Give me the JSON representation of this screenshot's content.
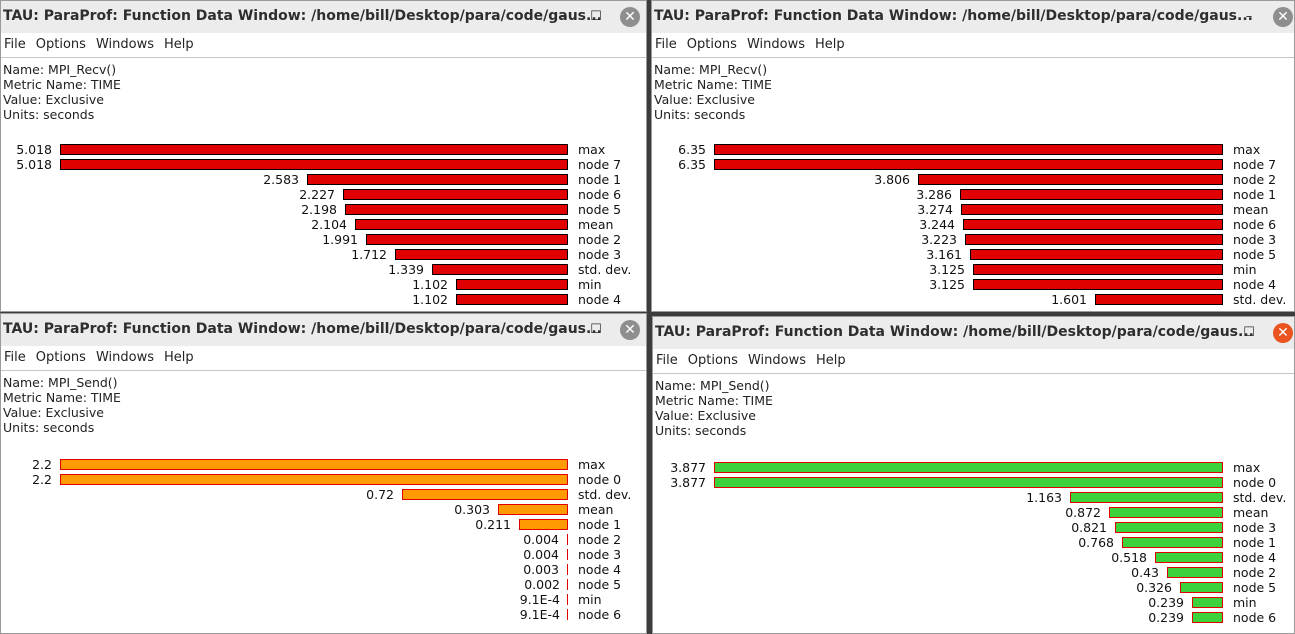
{
  "menu": [
    "File",
    "Options",
    "Windows",
    "Help"
  ],
  "windows": [
    {
      "title": "TAU: ParaProf: Function Data Window: /home/bill/Desktop/para/code/gaus...",
      "info": {
        "name": "Name: MPI_Recv()",
        "metric": "Metric Name: TIME",
        "value": "Value: Exclusive",
        "units": "Units: seconds"
      },
      "bar_color": "red",
      "max_value": 5.018,
      "rows": [
        {
          "value": "5.018",
          "v": 5.018,
          "label": "max"
        },
        {
          "value": "5.018",
          "v": 5.018,
          "label": "node 7"
        },
        {
          "value": "2.583",
          "v": 2.583,
          "label": "node 1"
        },
        {
          "value": "2.227",
          "v": 2.227,
          "label": "node 6"
        },
        {
          "value": "2.198",
          "v": 2.198,
          "label": "node 5"
        },
        {
          "value": "2.104",
          "v": 2.104,
          "label": "mean"
        },
        {
          "value": "1.991",
          "v": 1.991,
          "label": "node 2"
        },
        {
          "value": "1.712",
          "v": 1.712,
          "label": "node 3"
        },
        {
          "value": "1.339",
          "v": 1.339,
          "label": "std. dev."
        },
        {
          "value": "1.102",
          "v": 1.102,
          "label": "min"
        },
        {
          "value": "1.102",
          "v": 1.102,
          "label": "node 4"
        }
      ]
    },
    {
      "title": "TAU: ParaProf: Function Data Window: /home/bill/Desktop/para/code/gaus...",
      "info": {
        "name": "Name: MPI_Recv()",
        "metric": "Metric Name: TIME",
        "value": "Value: Exclusive",
        "units": "Units: seconds"
      },
      "bar_color": "red",
      "max_value": 6.35,
      "rows": [
        {
          "value": "6.35",
          "v": 6.35,
          "label": "max"
        },
        {
          "value": "6.35",
          "v": 6.35,
          "label": "node 7"
        },
        {
          "value": "3.806",
          "v": 3.806,
          "label": "node 2"
        },
        {
          "value": "3.286",
          "v": 3.286,
          "label": "node 1"
        },
        {
          "value": "3.274",
          "v": 3.274,
          "label": "mean"
        },
        {
          "value": "3.244",
          "v": 3.244,
          "label": "node 6"
        },
        {
          "value": "3.223",
          "v": 3.223,
          "label": "node 3"
        },
        {
          "value": "3.161",
          "v": 3.161,
          "label": "node 5"
        },
        {
          "value": "3.125",
          "v": 3.125,
          "label": "min"
        },
        {
          "value": "3.125",
          "v": 3.125,
          "label": "node 4"
        },
        {
          "value": "1.601",
          "v": 1.601,
          "label": "std. dev."
        }
      ]
    },
    {
      "title": "TAU: ParaProf: Function Data Window: /home/bill/Desktop/para/code/gaus...",
      "info": {
        "name": "Name: MPI_Send()",
        "metric": "Metric Name: TIME",
        "value": "Value: Exclusive",
        "units": "Units: seconds"
      },
      "bar_color": "orange",
      "max_value": 2.2,
      "rows": [
        {
          "value": "2.2",
          "v": 2.2,
          "label": "max"
        },
        {
          "value": "2.2",
          "v": 2.2,
          "label": "node 0"
        },
        {
          "value": "0.72",
          "v": 0.72,
          "label": "std. dev."
        },
        {
          "value": "0.303",
          "v": 0.303,
          "label": "mean"
        },
        {
          "value": "0.211",
          "v": 0.211,
          "label": "node 1"
        },
        {
          "value": "0.004",
          "v": 0.004,
          "label": "node 2"
        },
        {
          "value": "0.004",
          "v": 0.004,
          "label": "node 3"
        },
        {
          "value": "0.003",
          "v": 0.003,
          "label": "node 4"
        },
        {
          "value": "0.002",
          "v": 0.002,
          "label": "node 5"
        },
        {
          "value": "9.1E-4",
          "v": 0.00091,
          "label": "min"
        },
        {
          "value": "9.1E-4",
          "v": 0.00091,
          "label": "node 6"
        }
      ]
    },
    {
      "title": "TAU: ParaProf: Function Data Window: /home/bill/Desktop/para/code/gaus...",
      "info": {
        "name": "Name: MPI_Send()",
        "metric": "Metric Name: TIME",
        "value": "Value: Exclusive",
        "units": "Units: seconds"
      },
      "bar_color": "green",
      "max_value": 3.877,
      "rows": [
        {
          "value": "3.877",
          "v": 3.877,
          "label": "max"
        },
        {
          "value": "3.877",
          "v": 3.877,
          "label": "node 0"
        },
        {
          "value": "1.163",
          "v": 1.163,
          "label": "std. dev."
        },
        {
          "value": "0.872",
          "v": 0.872,
          "label": "mean"
        },
        {
          "value": "0.821",
          "v": 0.821,
          "label": "node 3"
        },
        {
          "value": "0.768",
          "v": 0.768,
          "label": "node 1"
        },
        {
          "value": "0.518",
          "v": 0.518,
          "label": "node 4"
        },
        {
          "value": "0.43",
          "v": 0.43,
          "label": "node 2"
        },
        {
          "value": "0.326",
          "v": 0.326,
          "label": "node 5"
        },
        {
          "value": "0.239",
          "v": 0.239,
          "label": "min"
        },
        {
          "value": "0.239",
          "v": 0.239,
          "label": "node 6"
        }
      ]
    }
  ]
}
